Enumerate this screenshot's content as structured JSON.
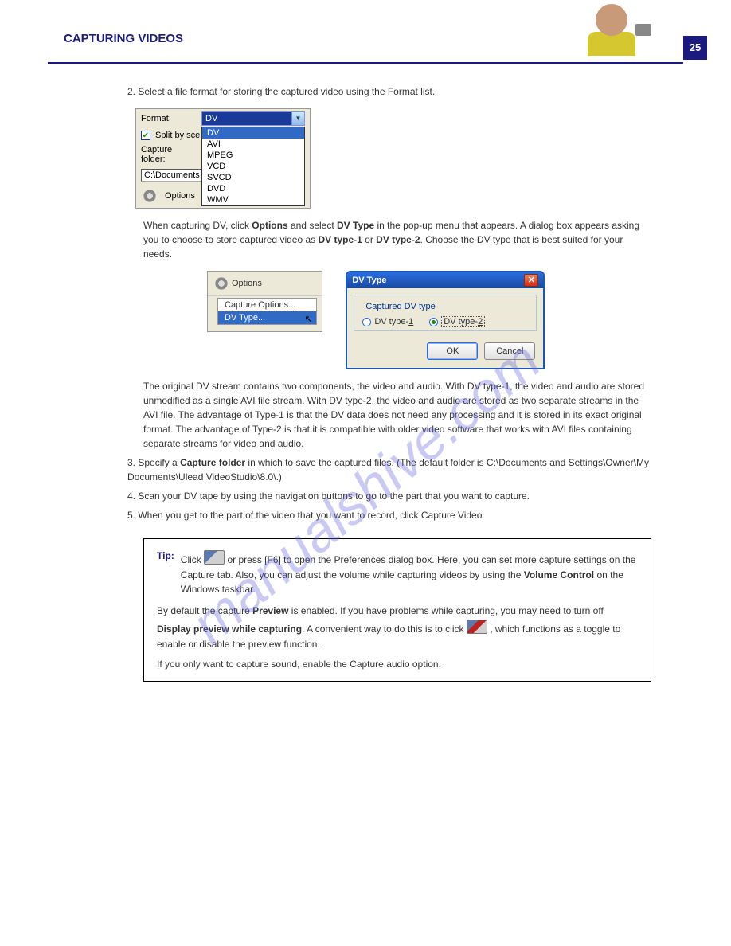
{
  "header": {
    "title": "CAPTURING VIDEOS",
    "page": "25"
  },
  "intro": "2. Select a file format for storing the captured video using the Format list.",
  "fmt": {
    "format_label": "Format:",
    "format_value": "DV",
    "options": [
      "DV",
      "AVI",
      "MPEG",
      "VCD",
      "SVCD",
      "DVD",
      "WMV"
    ],
    "split_label": "Split by sce",
    "capture_folder_label": "Capture folder:",
    "capture_folder_value": "C:\\Documents",
    "options_btn": "Options"
  },
  "dvnote": {
    "lead1": "When capturing DV, click ",
    "bold1": "Options",
    "mid1": " and select ",
    "bold2": "DV Type",
    "mid2": " in the pop-up menu that appears. A dialog box appears asking you to choose to store captured video as ",
    "bold3": "DV type-1",
    "mid3": " or ",
    "bold4": "DV type-2",
    "tail": ". Choose the DV type that is best suited for your needs."
  },
  "opt_menu": {
    "header": "Options",
    "items": [
      "Capture Options...",
      "DV Type..."
    ]
  },
  "dlg": {
    "title": "DV Type",
    "group": "Captured DV type",
    "r1": "DV type-1",
    "r1_key": "1",
    "r2": "DV type-2",
    "r2_key": "2",
    "ok": "OK",
    "cancel": "Cancel"
  },
  "dvexpl": "The original DV stream contains two components, the video and audio. With DV type-1, the video and audio are stored unmodified as a single AVI file stream. With DV type-2, the video and audio are stored as two separate streams in the AVI file. The advantage of Type-1 is that the DV data does not need any processing and it is stored in its exact original format. The advantage of Type-2 is that it is compatible with older video software that works with AVI files containing separate streams for video and audio.",
  "step3": {
    "num": "3.",
    "lead": "Specify a ",
    "bold": "Capture folder",
    "tail": " in which to save the captured files. (The default folder is C:\\Documents and Settings\\Owner\\My Documents\\Ulead VideoStudio\\8.0\\.)"
  },
  "step4": {
    "num": "4.",
    "text": "Scan your DV tape by using the navigation buttons to go to the part that you want to capture."
  },
  "step5": {
    "num": "5.",
    "text": "When you get to the part of the video that you want to record, click Capture Video."
  },
  "tip": {
    "label": "Tip:",
    "lead": "Click ",
    "set": "or press [F6] to open the Preferences dialog box. Here, you can set more capture settings on the Capture tab. Also, you can adjust the volume while capturing videos by using the ",
    "vol_bold": "Volume Control",
    "after_vol": " on the Windows taskbar.",
    "p2a": "By default the capture ",
    "p2b": "Preview",
    "p2c": " is enabled. If you have problems while capturing, you may need to turn off ",
    "p2d": "Display preview while capturing",
    "p2e": ". A convenient way to do this is to click",
    "p2f": ", which functions as a toggle to enable or ",
    "p2g": "disable the preview function.",
    "p3": "If you only want to capture sound, enable the Capture audio option."
  },
  "watermark": "manualshive.com"
}
